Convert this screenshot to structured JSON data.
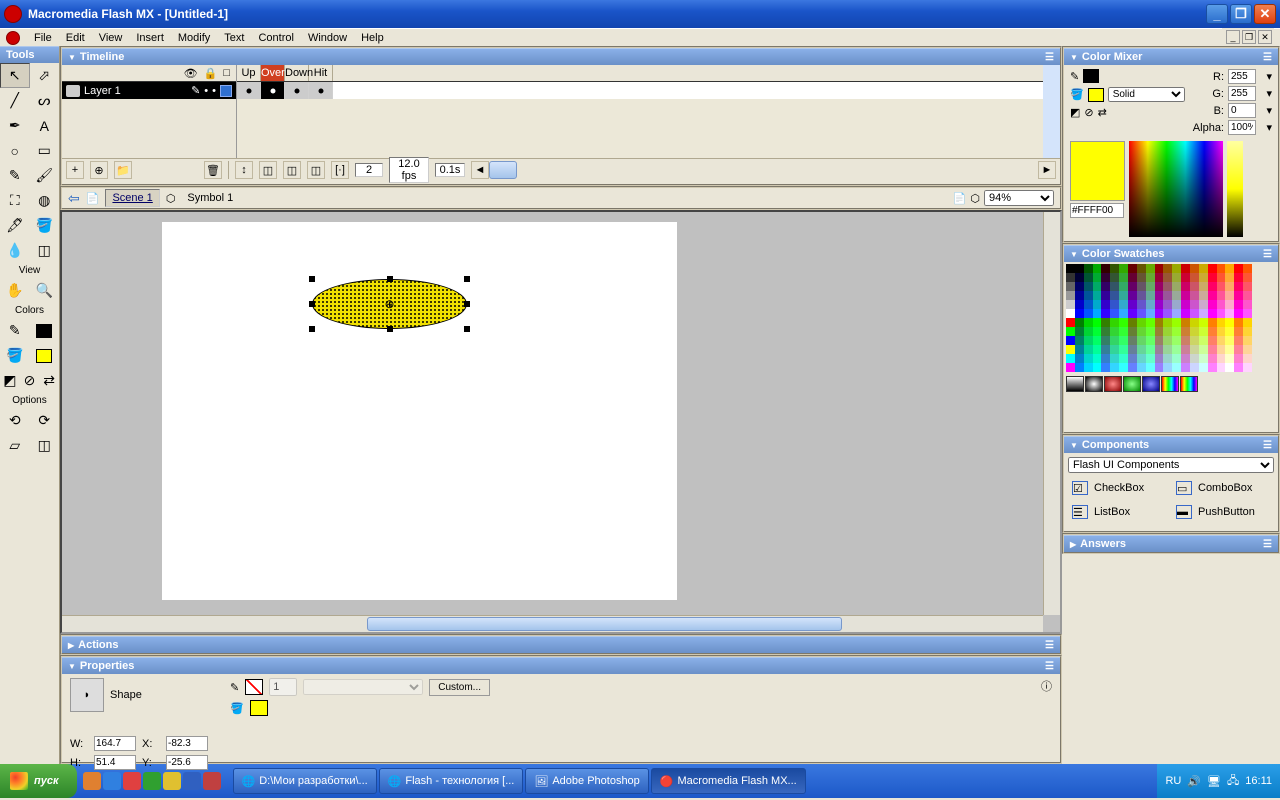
{
  "app": {
    "title": "Macromedia Flash MX - [Untitled-1]"
  },
  "menu": [
    "File",
    "Edit",
    "View",
    "Insert",
    "Modify",
    "Text",
    "Control",
    "Window",
    "Help"
  ],
  "panels": {
    "tools": "Tools",
    "view": "View",
    "colors": "Colors",
    "options": "Options",
    "timeline": "Timeline",
    "actions": "Actions",
    "properties": "Properties",
    "colorMixer": "Color Mixer",
    "colorSwatches": "Color Swatches",
    "components": "Components",
    "answers": "Answers"
  },
  "timeline": {
    "layerName": "Layer 1",
    "frameLabels": [
      "Up",
      "Over",
      "Down",
      "Hit"
    ],
    "activeFrameLabel": "Over",
    "currentFrame": "2",
    "fps": "12.0 fps",
    "time": "0.1s"
  },
  "editbar": {
    "scene": "Scene 1",
    "symbol": "Symbol 1",
    "zoom": "94%"
  },
  "properties": {
    "type": "Shape",
    "w": "164.7",
    "h": "51.4",
    "x": "-82.3",
    "y": "-25.6",
    "W": "W:",
    "H": "H:",
    "X": "X:",
    "Y": "Y:",
    "custom": "Custom..."
  },
  "mixer": {
    "fillType": "Solid",
    "r": "255",
    "g": "255",
    "b": "0",
    "alpha": "100%",
    "hex": "#FFFF00",
    "R": "R:",
    "G": "G:",
    "B": "B:",
    "A": "Alpha:"
  },
  "components": {
    "select": "Flash UI Components",
    "items": [
      "CheckBox",
      "ComboBox",
      "ListBox",
      "PushButton"
    ]
  },
  "taskbar": {
    "start": "пуск",
    "items": [
      "D:\\Мои разработки\\...",
      "Flash - технология [...",
      "Adobe Photoshop",
      "Macromedia Flash MX..."
    ],
    "lang": "RU",
    "clock": "16:11"
  }
}
